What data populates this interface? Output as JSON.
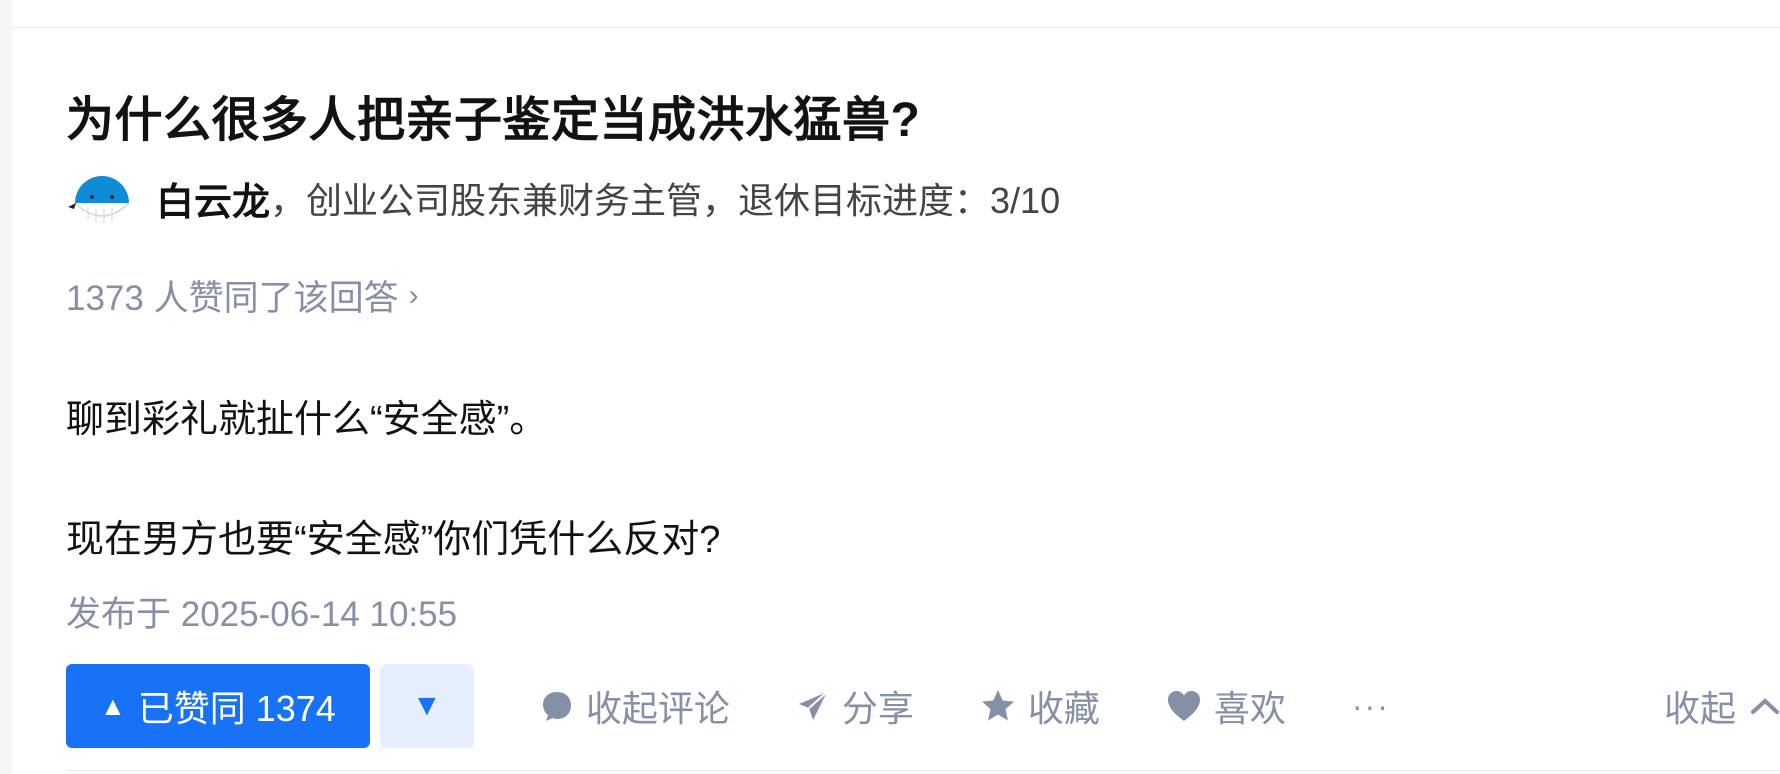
{
  "question": {
    "title": "为什么很多人把亲子鉴定当成洪水猛兽?"
  },
  "author": {
    "name": "白云龙",
    "separator": "，",
    "bio": "创业公司股东兼财务主管，退休目标进度：3/10"
  },
  "votes_summary": {
    "text": "1373 人赞同了该回答",
    "chevron": "›"
  },
  "answer": {
    "paragraphs": [
      "聊到彩礼就扯什么“安全感”。",
      "现在男方也要“安全感”你们凭什么反对?"
    ],
    "published": "发布于 2025-06-14 10:55"
  },
  "actions": {
    "upvote_label": "已赞同 1374",
    "upvote_icon": "▲",
    "downvote_icon": "▼",
    "comments_label": "收起评论",
    "share_label": "分享",
    "favorite_label": "收藏",
    "like_label": "喜欢",
    "more_label": "···",
    "collapse_label": "收起"
  },
  "colors": {
    "accent": "#1772f6",
    "accent_light": "#e5effe",
    "muted": "#8590a6",
    "text": "#121212",
    "avatar_blue": "#0f8cd8"
  }
}
